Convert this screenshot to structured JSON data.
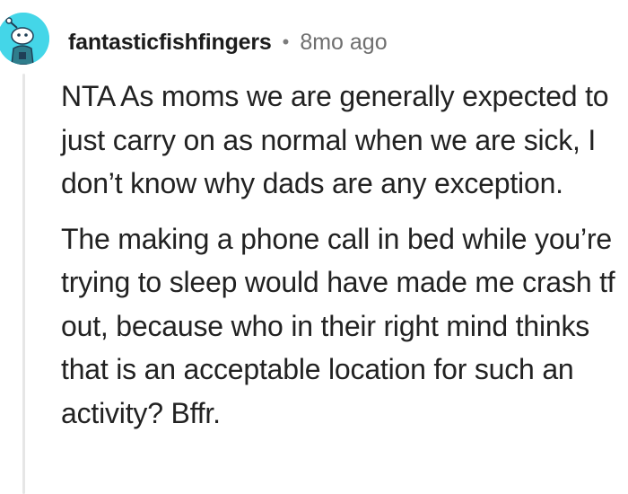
{
  "comment": {
    "author": "fantasticfishfingers",
    "separator": "•",
    "age": "8mo ago",
    "paragraphs": [
      "NTA As moms we are generally expected to just carry on as normal when we are sick, I don’t know why dads are any exception.",
      "The making a phone call in bed while you’re trying to sleep would have made me crash tf out, because who in their right mind thinks that is an acceptable location for such an activity? Bffr."
    ]
  },
  "colors": {
    "avatar_background": "#44d6e8",
    "thread_line": "#e6e6e6"
  },
  "icons": {
    "avatar": "snoo-avatar-icon"
  }
}
